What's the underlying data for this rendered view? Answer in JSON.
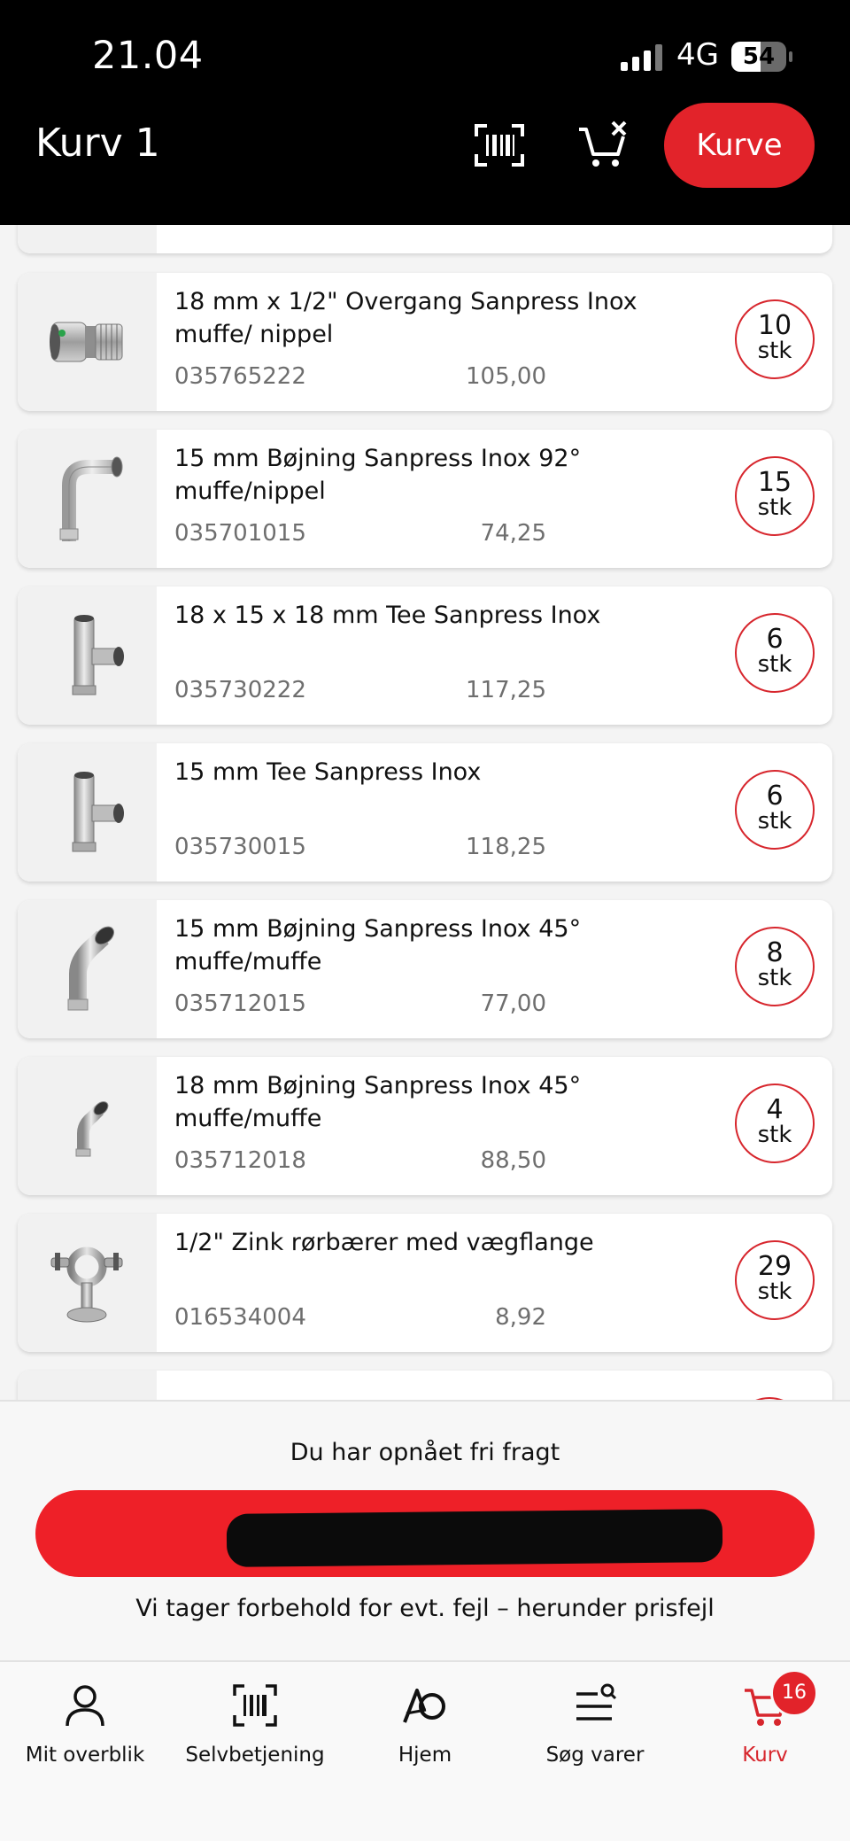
{
  "status_bar": {
    "time": "21.04",
    "network": "4G",
    "battery": "54",
    "battery_level_percent": 54
  },
  "header": {
    "title": "Kurv 1",
    "basket_button": "Kurve",
    "barcode_icon": "barcode-scan-icon",
    "clear_cart_icon": "cart-remove-icon"
  },
  "cart_items": [
    {
      "name": "18 mm x 1/2\" Overgang Sanpress Inox muffe/ nippel",
      "sku": "035765222",
      "price": "105,00",
      "qty": "10",
      "unit": "stk",
      "icon": "adapter-fitting-icon"
    },
    {
      "name": "15 mm Bøjning Sanpress Inox 92° muffe/nippel",
      "sku": "035701015",
      "price": "74,25",
      "qty": "15",
      "unit": "stk",
      "icon": "elbow-92-fitting-icon"
    },
    {
      "name": "18 x 15 x 18 mm Tee Sanpress Inox",
      "sku": "035730222",
      "price": "117,25",
      "qty": "6",
      "unit": "stk",
      "icon": "tee-fitting-icon"
    },
    {
      "name": "15 mm Tee Sanpress Inox",
      "sku": "035730015",
      "price": "118,25",
      "qty": "6",
      "unit": "stk",
      "icon": "tee-fitting-icon"
    },
    {
      "name": "15 mm Bøjning Sanpress Inox 45° muffe/muffe",
      "sku": "035712015",
      "price": "77,00",
      "qty": "8",
      "unit": "stk",
      "icon": "elbow-45-fitting-icon"
    },
    {
      "name": "18 mm Bøjning Sanpress Inox 45° muffe/muffe",
      "sku": "035712018",
      "price": "88,50",
      "qty": "4",
      "unit": "stk",
      "icon": "elbow-45-fitting-icon"
    },
    {
      "name": "1/2\" Zink rørbærer med vægflange",
      "sku": "016534004",
      "price": "8,92",
      "qty": "29",
      "unit": "stk",
      "icon": "pipe-clamp-icon"
    }
  ],
  "checkout": {
    "freight_notice": "Du har opnået fri fragt",
    "disclaimer": "Vi tager forbehold for evt. fejl – herunder prisfejl"
  },
  "tabs": [
    {
      "label": "Mit overblik",
      "icon": "person-icon"
    },
    {
      "label": "Selvbetjening",
      "icon": "barcode-scan-icon"
    },
    {
      "label": "Hjem",
      "icon": "ao-logo-icon"
    },
    {
      "label": "Søg varer",
      "icon": "search-list-icon"
    },
    {
      "label": "Kurv",
      "icon": "cart-icon",
      "badge": "16",
      "active": true
    }
  ],
  "colors": {
    "accent": "#e2232a",
    "header_bg": "#000000",
    "list_bg": "#f4f4f4"
  }
}
